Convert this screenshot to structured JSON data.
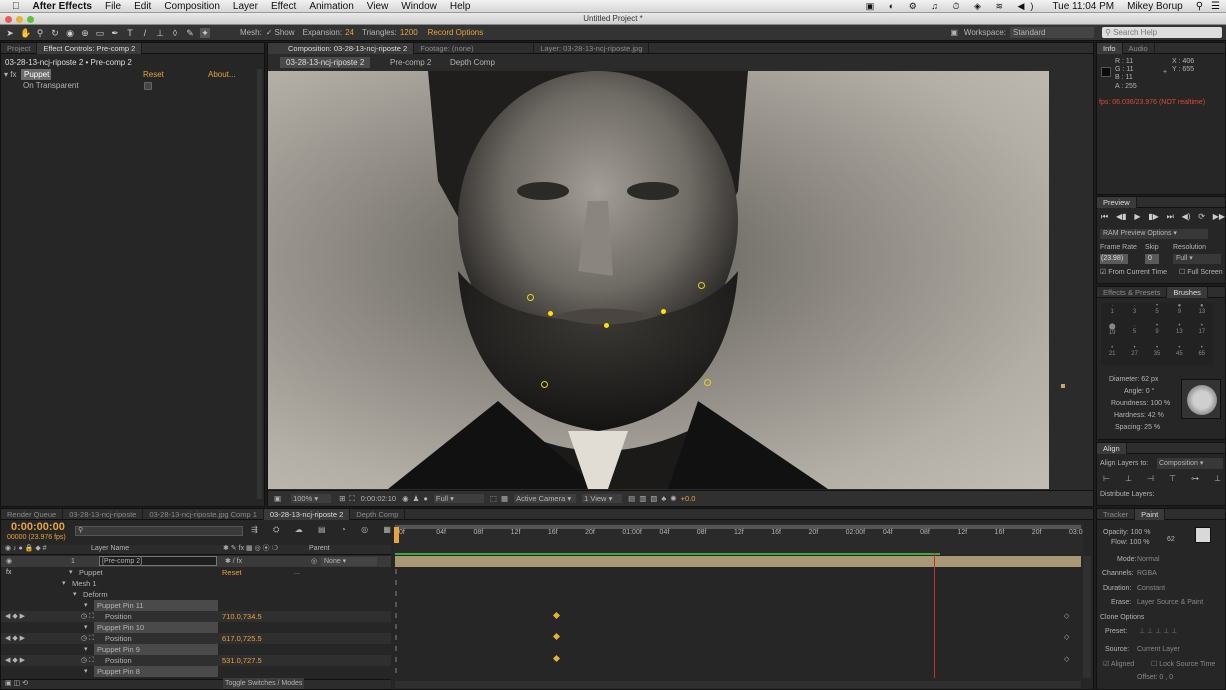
{
  "menubar": {
    "apple": "",
    "app": "After Effects",
    "items": [
      "File",
      "Edit",
      "Composition",
      "Layer",
      "Effect",
      "Animation",
      "View",
      "Window",
      "Help"
    ],
    "clock": "Tue 11:04 PM",
    "user": "Mikey Borup"
  },
  "window": {
    "title": "Untitled Project *"
  },
  "toolbar": {
    "mesh_label": "Mesh:",
    "show_label": "Show",
    "expansion_label": "Expansion:",
    "expansion_value": "24",
    "triangles_label": "Triangles:",
    "triangles_value": "1200",
    "record_options": "Record Options",
    "workspace_label": "Workspace:",
    "workspace_value": "Standard",
    "search_placeholder": "Search Help"
  },
  "left_panel": {
    "tab_project": "Project",
    "tab_effect_controls": "Effect Controls: Pre-comp 2",
    "breadcrumb": "03-28-13-ncj-riposte 2 • Pre-comp 2",
    "effect_name": "Puppet",
    "reset": "Reset",
    "about": "About...",
    "option_label": "On Transparent"
  },
  "viewer": {
    "tab_composition": "Composition: 03-28-13-ncj-riposte 2",
    "tab_footage": "Footage: (none)",
    "tab_layer": "Layer: 03-28-13-ncj-riposte.jpg",
    "sub_tabs": [
      "03-28-13-ncj-riposte 2",
      "Pre-comp 2",
      "Depth Comp"
    ],
    "zoom": "100%",
    "timecode": "0:00:02:10",
    "resolution": "Full",
    "camera": "Active Camera",
    "views": "1 View",
    "exposure": "+0.0"
  },
  "info": {
    "tab_info": "Info",
    "tab_audio": "Audio",
    "r": "R : 11",
    "g": "G : 11",
    "b": "B : 11",
    "a": "A : 255",
    "x": "X : 406",
    "y": "Y : 655",
    "fps": "fps: 06.036/23.976 (NOT realtime)"
  },
  "preview": {
    "title": "Preview",
    "ram_options": "RAM Preview Options",
    "frame_rate_label": "Frame Rate",
    "skip_label": "Skip",
    "resolution_label": "Resolution",
    "frame_rate": "(23.98)",
    "skip": "0",
    "resolution": "Full",
    "from_current": "From Current Time",
    "full_screen": "Full Screen"
  },
  "brushes": {
    "tab_effects": "Effects & Presets",
    "tab_brushes": "Brushes",
    "sizes": [
      "1",
      "3",
      "5",
      "9",
      "13",
      "19",
      "5",
      "9",
      "13",
      "17",
      "21",
      "27",
      "35",
      "45",
      "65"
    ],
    "diameter": "Diameter: 62 px",
    "angle": "Angle: 0 °",
    "roundness": "Roundness: 100 %",
    "hardness": "Hardness: 42 %",
    "spacing": "Spacing: 25 %"
  },
  "align": {
    "title": "Align",
    "align_to_label": "Align Layers to:",
    "align_to_value": "Composition",
    "distribute": "Distribute Layers:"
  },
  "paint": {
    "tab_tracker": "Tracker",
    "tab_paint": "Paint",
    "opacity": "Opacity: 100 %",
    "flow": "Flow: 100 %",
    "size_value": "62",
    "mode_label": "Mode:",
    "mode_value": "Normal",
    "channels_label": "Channels:",
    "channels_value": "RGBA",
    "duration_label": "Duration:",
    "duration_value": "Constant",
    "erase_label": "Erase:",
    "erase_value": "Layer Source & Paint",
    "clone_options": "Clone Options",
    "preset_label": "Preset:",
    "source_label": "Source:",
    "source_value": "Current Layer",
    "aligned": "Aligned",
    "lock_source": "Lock Source Time",
    "offset": "Offset: 0 , 0"
  },
  "timeline": {
    "tabs": [
      "Render Queue",
      "03-28-13-ncj-riposte",
      "03-28-13-ncj-riposte.jpg Comp 1",
      "03-28-13-ncj-riposte 2",
      "Depth Comp"
    ],
    "timecode": "0:00:00:00",
    "timecode_sub": "00000 (23.976 fps)",
    "col_layer_name": "Layer Name",
    "col_parent": "Parent",
    "layer_num": "1",
    "layer_name": "[Pre-comp 2]",
    "parent_value": "None",
    "toggle": "Toggle Switches / Modes",
    "ruler": [
      "0f",
      "04f",
      "08f",
      "12f",
      "16f",
      "20f",
      "01:00f",
      "04f",
      "08f",
      "12f",
      "16f",
      "20f",
      "02:00f",
      "04f",
      "08f",
      "12f",
      "16f",
      "20f",
      "03:0"
    ],
    "rows": [
      {
        "indent": 0,
        "label": "Puppet",
        "value": "Reset",
        "kind": "effect"
      },
      {
        "indent": 1,
        "label": "Mesh 1",
        "value": "",
        "kind": "group"
      },
      {
        "indent": 2,
        "label": "Deform",
        "value": "",
        "kind": "group"
      },
      {
        "indent": 3,
        "label": "Puppet Pin 11",
        "value": "",
        "kind": "pin"
      },
      {
        "indent": 4,
        "label": "Position",
        "value": "710.0,734.5",
        "kind": "prop"
      },
      {
        "indent": 3,
        "label": "Puppet Pin 10",
        "value": "",
        "kind": "pin"
      },
      {
        "indent": 4,
        "label": "Position",
        "value": "617.0,725.5",
        "kind": "prop"
      },
      {
        "indent": 3,
        "label": "Puppet Pin 9",
        "value": "",
        "kind": "pin"
      },
      {
        "indent": 4,
        "label": "Position",
        "value": "531.0,727.5",
        "kind": "prop"
      },
      {
        "indent": 3,
        "label": "Puppet Pin 8",
        "value": "",
        "kind": "pin"
      }
    ]
  }
}
